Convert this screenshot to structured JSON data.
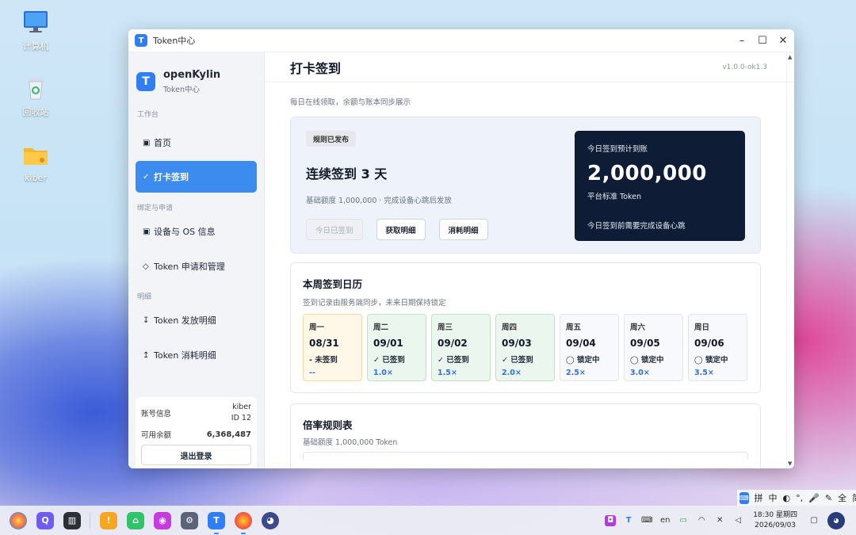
{
  "desktop": {
    "icons": [
      {
        "label": "计算机",
        "icon": "monitor-icon"
      },
      {
        "label": "回收站",
        "icon": "recycle-bin-icon"
      },
      {
        "label": "kiber",
        "icon": "folder-icon"
      }
    ]
  },
  "window": {
    "title": "Token中心",
    "controls": [
      "–",
      "☐",
      "✕"
    ]
  },
  "sidebar": {
    "brand_name": "openKylin",
    "brand_sub": "Token中心",
    "sections": [
      {
        "label": "工作台"
      },
      {
        "label": "绑定与申请"
      },
      {
        "label": "明细"
      }
    ],
    "items": [
      {
        "icon": "▣",
        "label": "首页"
      },
      {
        "icon": "✓",
        "label": "打卡签到"
      },
      {
        "icon": "▣",
        "label": "设备与 OS 信息"
      },
      {
        "icon": "◇",
        "label": "Token 申请和管理"
      },
      {
        "icon": "↧",
        "label": "Token 发放明细"
      },
      {
        "icon": "↥",
        "label": "Token 消耗明细"
      }
    ],
    "account": {
      "label": "账号信息",
      "user": "kiber",
      "id": "ID 12",
      "balance_label": "可用余额",
      "balance": "6,368,487",
      "logout": "退出登录"
    }
  },
  "main": {
    "title": "打卡签到",
    "version": "v1.0.0-ok1.3",
    "description": "每日在线领取，余额与账本同步展示",
    "hero": {
      "badge": "规则已发布",
      "title": "连续签到 3 天",
      "note": "基础额度 1,000,000 · 完成设备心跳后发放",
      "buttons": {
        "checked_in": "今日已签到",
        "get_details": "获取明细",
        "consume_details": "消耗明细"
      },
      "card": {
        "label": "今日签到预计到账",
        "amount": "2,000,000",
        "unit": "平台标准 Token",
        "tip": "今日签到前需要完成设备心跳"
      }
    },
    "calendar": {
      "title": "本周签到日历",
      "subtitle": "签到记录由服务端同步，未来日期保持锁定",
      "days": [
        {
          "week": "周一",
          "date": "08/31",
          "status": "- 未签到",
          "multiplier": "--",
          "state": "today"
        },
        {
          "week": "周二",
          "date": "09/01",
          "status": "✓ 已签到",
          "multiplier": "1.0×",
          "state": "done"
        },
        {
          "week": "周三",
          "date": "09/02",
          "status": "✓ 已签到",
          "multiplier": "1.5×",
          "state": "done"
        },
        {
          "week": "周四",
          "date": "09/03",
          "status": "✓ 已签到",
          "multiplier": "2.0×",
          "state": "done"
        },
        {
          "week": "周五",
          "date": "09/04",
          "status": "◯ 锁定中",
          "multiplier": "2.5×",
          "state": "locked"
        },
        {
          "week": "周六",
          "date": "09/05",
          "status": "◯ 锁定中",
          "multiplier": "3.0×",
          "state": "locked"
        },
        {
          "week": "周日",
          "date": "09/06",
          "status": "◯ 锁定中",
          "multiplier": "3.5×",
          "state": "locked"
        }
      ]
    },
    "rules": {
      "title": "倍率规则表",
      "subtitle": "基础额度 1,000,000 Token"
    }
  },
  "ime": {
    "items": [
      "拼",
      "中",
      "◐",
      "°,",
      "🎤",
      "✎",
      "全",
      "简"
    ]
  },
  "taskbar": {
    "time": "18:30 星期四",
    "date": "2026/09/03",
    "lang": "en"
  },
  "colors": {
    "accent": "#3c8cf0",
    "dark_card": "#0f1c35",
    "done_bg": "#ebf7ee",
    "today_bg": "#fff7e8",
    "multiplier": "#2f6fde"
  }
}
